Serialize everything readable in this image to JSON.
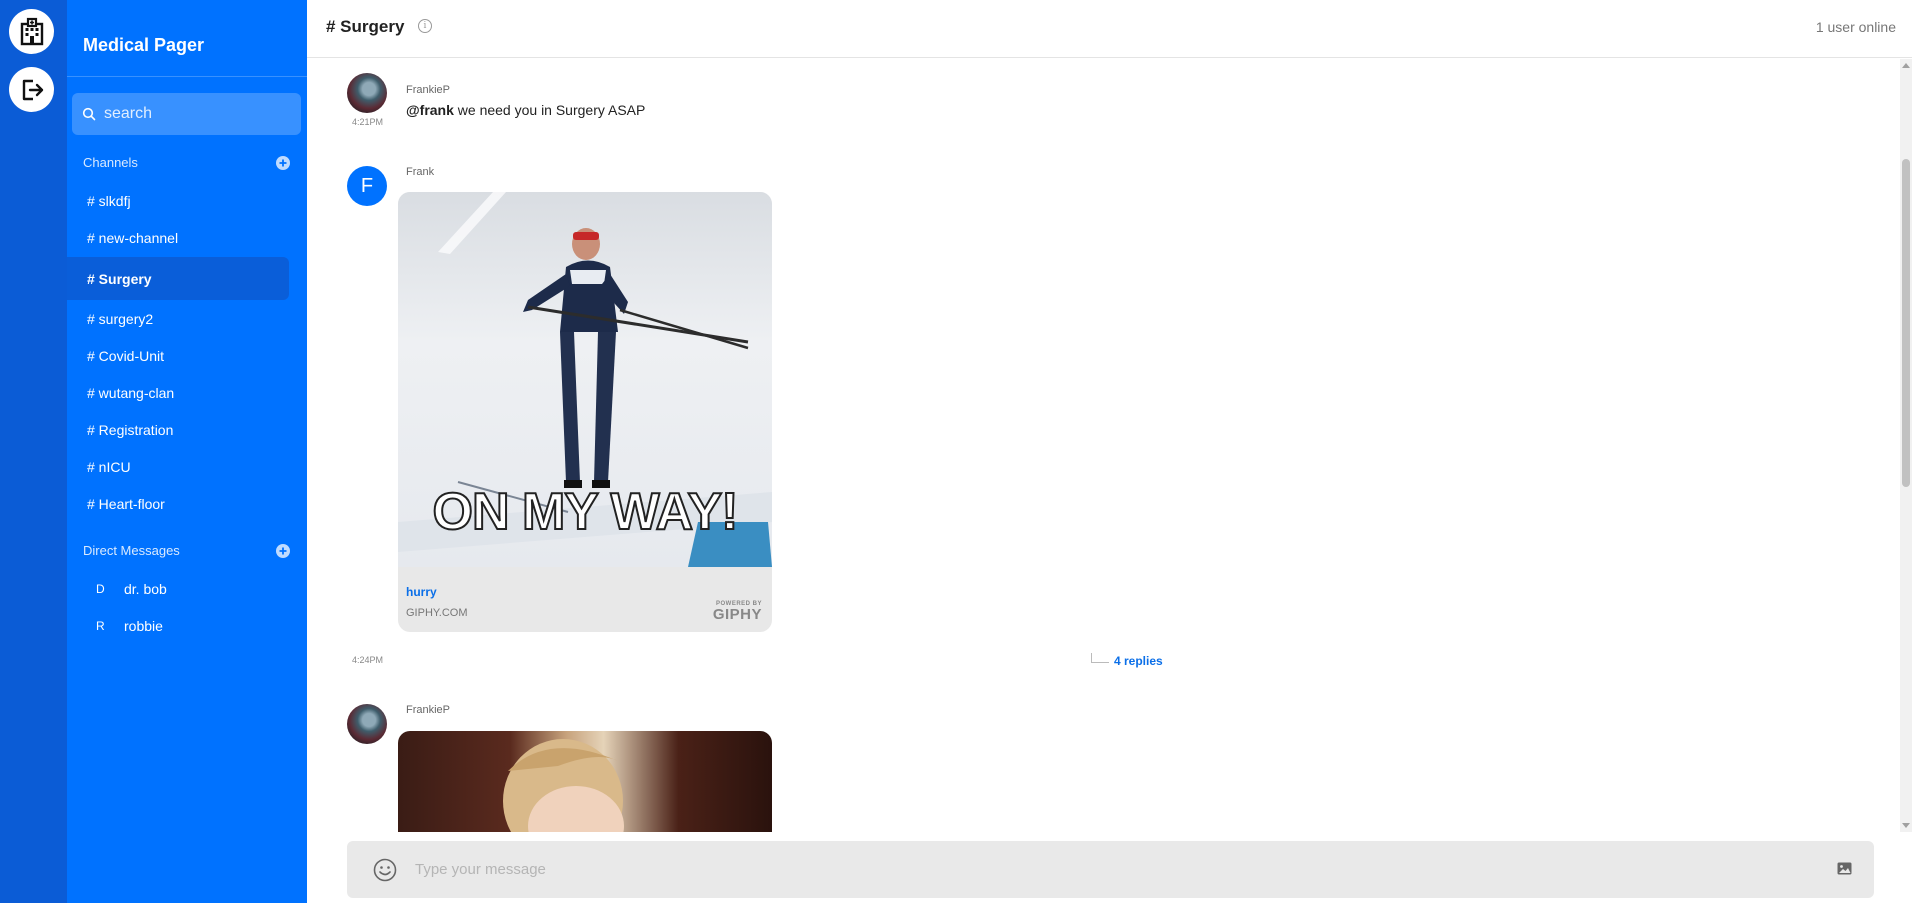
{
  "rail": {
    "items": [
      {
        "icon": "hospital-icon"
      },
      {
        "icon": "logout-icon"
      }
    ]
  },
  "sidebar": {
    "brand": "Medical Pager",
    "search_placeholder": "search",
    "channels_title": "Channels",
    "channels": [
      {
        "label": "# slkdfj"
      },
      {
        "label": "# new-channel"
      },
      {
        "label": "# Surgery",
        "active": true
      },
      {
        "label": "# surgery2"
      },
      {
        "label": "# Covid-Unit"
      },
      {
        "label": "# wutang-clan"
      },
      {
        "label": "# Registration"
      },
      {
        "label": "# nICU"
      },
      {
        "label": "# Heart-floor"
      }
    ],
    "dm_title": "Direct Messages",
    "dms": [
      {
        "initial": "D",
        "name": "dr. bob"
      },
      {
        "initial": "R",
        "name": "robbie"
      }
    ]
  },
  "header": {
    "title": "# Surgery",
    "online": "1 user online"
  },
  "messages": [
    {
      "author": "FrankieP",
      "time": "4:21PM",
      "mention": "@frank",
      "text": " we need you in Surgery ASAP"
    },
    {
      "author": "Frank",
      "avatar_letter": "F",
      "time": "4:24PM",
      "gif_caption": "ON MY WAY!",
      "link_title": "hurry",
      "link_source": "GIPHY.COM",
      "giphy_small": "POWERED BY",
      "giphy_big": "GIPHY",
      "replies": "4 replies"
    },
    {
      "author": "FrankieP"
    }
  ],
  "composer": {
    "placeholder": "Type your message"
  },
  "colors": {
    "rail": "#0b5cd6",
    "sidebar": "#0072ff",
    "accent": "#0b6fe8"
  }
}
